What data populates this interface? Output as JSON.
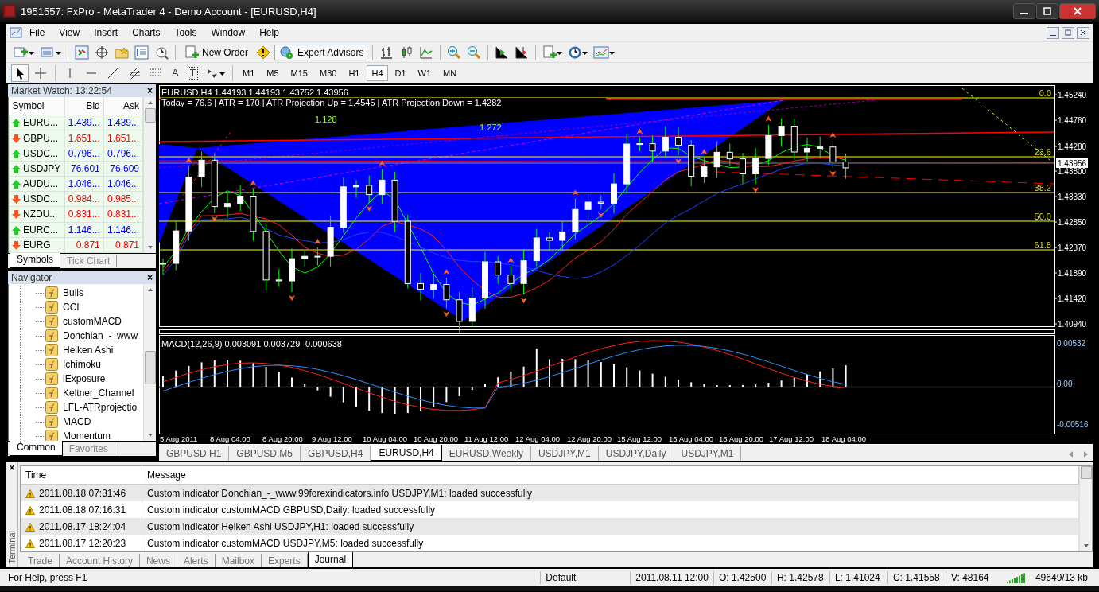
{
  "window": {
    "title": "1951557: FxPro - MetaTrader 4 - Demo Account - [EURUSD,H4]"
  },
  "menu": [
    "File",
    "View",
    "Insert",
    "Charts",
    "Tools",
    "Window",
    "Help"
  ],
  "toolbar": {
    "buttons": [
      {
        "label": "New Order",
        "on": false
      },
      {
        "label": "Expert Advisors",
        "on": true
      }
    ]
  },
  "drawing_tools": {
    "text_tool": "A",
    "text_label_tool": "T"
  },
  "timeframes": [
    {
      "label": "M1",
      "selected": false
    },
    {
      "label": "M5",
      "selected": false
    },
    {
      "label": "M15",
      "selected": false
    },
    {
      "label": "M30",
      "selected": false
    },
    {
      "label": "H1",
      "selected": false
    },
    {
      "label": "H4",
      "selected": true
    },
    {
      "label": "D1",
      "selected": false
    },
    {
      "label": "W1",
      "selected": false
    },
    {
      "label": "MN",
      "selected": false
    }
  ],
  "market_watch": {
    "title": "Market Watch: 13:22:54",
    "close": "×",
    "columns": [
      "Symbol",
      "Bid",
      "Ask"
    ],
    "rows": [
      {
        "symbol": "EURU...",
        "bid": "1.439...",
        "ask": "1.439...",
        "rising": true
      },
      {
        "symbol": "GBPU...",
        "bid": "1.651...",
        "ask": "1.651...",
        "rising": false
      },
      {
        "symbol": "USDC...",
        "bid": "0.796...",
        "ask": "0.796...",
        "rising": true
      },
      {
        "symbol": "USDJPY",
        "bid": "76.601",
        "ask": "76.609",
        "rising": true
      },
      {
        "symbol": "AUDU...",
        "bid": "1.046...",
        "ask": "1.046...",
        "rising": true
      },
      {
        "symbol": "USDC...",
        "bid": "0.984...",
        "ask": "0.985...",
        "rising": false
      },
      {
        "symbol": "NZDU...",
        "bid": "0.831...",
        "ask": "0.831...",
        "rising": false
      },
      {
        "symbol": "EURC...",
        "bid": "1.146...",
        "ask": "1.146...",
        "rising": true
      },
      {
        "symbol": "EURG",
        "bid": "0.871",
        "ask": "0.871",
        "rising": false
      }
    ],
    "tabs": [
      {
        "label": "Symbols",
        "selected": true
      },
      {
        "label": "Tick Chart",
        "selected": false
      }
    ]
  },
  "navigator": {
    "title": "Navigator",
    "close": "×",
    "items": [
      "Bulls",
      "CCI",
      "customMACD",
      "Donchian_-_www",
      "Heiken Ashi",
      "Ichimoku",
      "iExposure",
      "Keltner_Channel",
      "LFL-ATRprojectio",
      "MACD",
      "Momentum"
    ],
    "tabs": [
      {
        "label": "Common",
        "selected": true
      },
      {
        "label": "Favorites",
        "selected": false
      }
    ]
  },
  "chart": {
    "header": "EURUSD,H4  1.44193 1.44193 1.43752 1.43956",
    "indicator_line": "Today = 76.6  |  ATR = 170  |  ATR Projection Up = 1.4545  |  ATR Projection Down = 1.4282",
    "pattern_labels": [
      "1.128",
      "1.272"
    ],
    "fib_levels": [
      "0.0",
      "23.6",
      "38.2",
      "50.0",
      "61.8"
    ],
    "price_axis": [
      "1.45240",
      "1.44760",
      "1.44280",
      "1.43800",
      "1.43330",
      "1.42850",
      "1.42370",
      "1.41890",
      "1.41420",
      "1.40940"
    ],
    "current_price": "1.43956",
    "macd_header": "MACD(12,26,9) 0.003091 0.003729 -0.000638",
    "macd_axis": [
      "0.00532",
      "0.00",
      "-0.00516"
    ],
    "time_axis": [
      "5 Aug 2011",
      "8 Aug 04:00",
      "8 Aug 20:00",
      "9 Aug 12:00",
      "10 Aug 04:00",
      "10 Aug 20:00",
      "11 Aug 12:00",
      "12 Aug 04:00",
      "12 Aug 20:00",
      "15 Aug 12:00",
      "16 Aug 04:00",
      "16 Aug 20:00",
      "17 Aug 12:00",
      "18 Aug 04:00"
    ]
  },
  "chart_tabs": [
    {
      "label": "GBPUSD,H1",
      "selected": false
    },
    {
      "label": "GBPUSD,M5",
      "selected": false
    },
    {
      "label": "GBPUSD,H4",
      "selected": false
    },
    {
      "label": "EURUSD,H4",
      "selected": true
    },
    {
      "label": "EURUSD,Weekly",
      "selected": false
    },
    {
      "label": "USDJPY,M1",
      "selected": false
    },
    {
      "label": "USDJPY,Daily",
      "selected": false
    },
    {
      "label": "USDJPY,M1",
      "selected": false
    }
  ],
  "terminal": {
    "side_label": "Terminal",
    "close": "×",
    "columns": [
      "Time",
      "Message"
    ],
    "rows": [
      {
        "time": "2011.08.18 07:31:46",
        "message": "Custom indicator Donchian_-_www.99forexindicators.info USDJPY,M1: loaded successfully"
      },
      {
        "time": "2011.08.18 07:16:31",
        "message": "Custom indicator customMACD GBPUSD,Daily: loaded successfully"
      },
      {
        "time": "2011.08.17 18:24:04",
        "message": "Custom indicator Heiken Ashi USDJPY,H1: loaded successfully"
      },
      {
        "time": "2011.08.17 12:20:23",
        "message": "Custom indicator customMACD USDJPY,M5: loaded successfully"
      }
    ],
    "tabs": [
      {
        "label": "Trade",
        "selected": false
      },
      {
        "label": "Account History",
        "selected": false
      },
      {
        "label": "News",
        "selected": false
      },
      {
        "label": "Alerts",
        "selected": false
      },
      {
        "label": "Mailbox",
        "selected": false
      },
      {
        "label": "Experts",
        "selected": false
      },
      {
        "label": "Journal",
        "selected": true
      }
    ]
  },
  "status_bar": {
    "help": "For Help, press F1",
    "profile": "Default",
    "time": "2011.08.11 12:00",
    "open": "O: 1.42500",
    "high": "H: 1.42578",
    "low": "L: 1.41024",
    "close": "C: 1.41558",
    "volume": "V: 48164",
    "traffic": "49649/13 kb"
  }
}
